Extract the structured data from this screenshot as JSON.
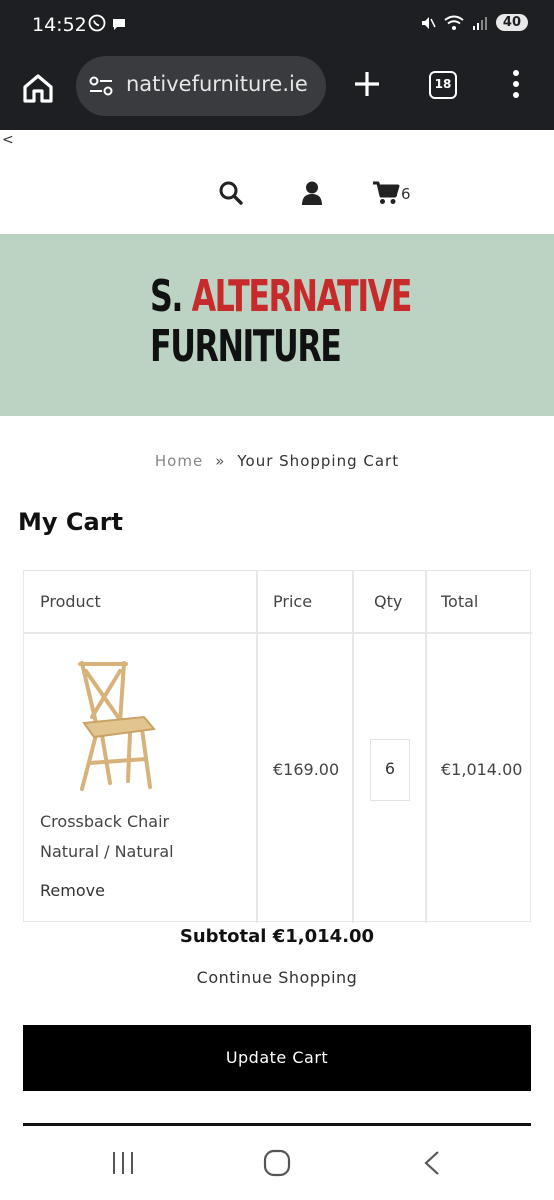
{
  "status": {
    "time": "14:52",
    "battery": "40"
  },
  "browser": {
    "url": "nativefurniture.ie",
    "tab_count": "18"
  },
  "header": {
    "cart_count": "6"
  },
  "logo": {
    "line1_black": "S.",
    "line1_red": "ALTERNATIVE",
    "line2": "FURNITURE"
  },
  "breadcrumb": {
    "home": "Home",
    "separator": "»",
    "current": "Your Shopping Cart"
  },
  "page_title": "My Cart",
  "cart": {
    "columns": [
      "Product",
      "Price",
      "Qty",
      "Total"
    ],
    "items": [
      {
        "name_line1": "Crossback Chair",
        "name_line2": "Natural / Natural",
        "remove_label": "Remove",
        "price": "€169.00",
        "qty": "6",
        "total": "€1,014.00"
      }
    ],
    "subtotal_label": "Subtotal €1,014.00",
    "continue_label": "Continue Shopping",
    "update_label": "Update Cart"
  },
  "colors": {
    "hero_bg": "#bcd3c3",
    "logo_red": "#c62a2a",
    "button_bg": "#000000"
  },
  "icons": [
    "whatsapp-icon",
    "chat-icon",
    "mute-icon",
    "wifi-icon",
    "signal-icon",
    "home-icon",
    "site-settings-icon",
    "plus-icon",
    "menu-icon",
    "search-icon",
    "user-icon",
    "cart-icon",
    "chair-image",
    "recent-apps-icon",
    "home-circle-icon",
    "back-icon"
  ]
}
